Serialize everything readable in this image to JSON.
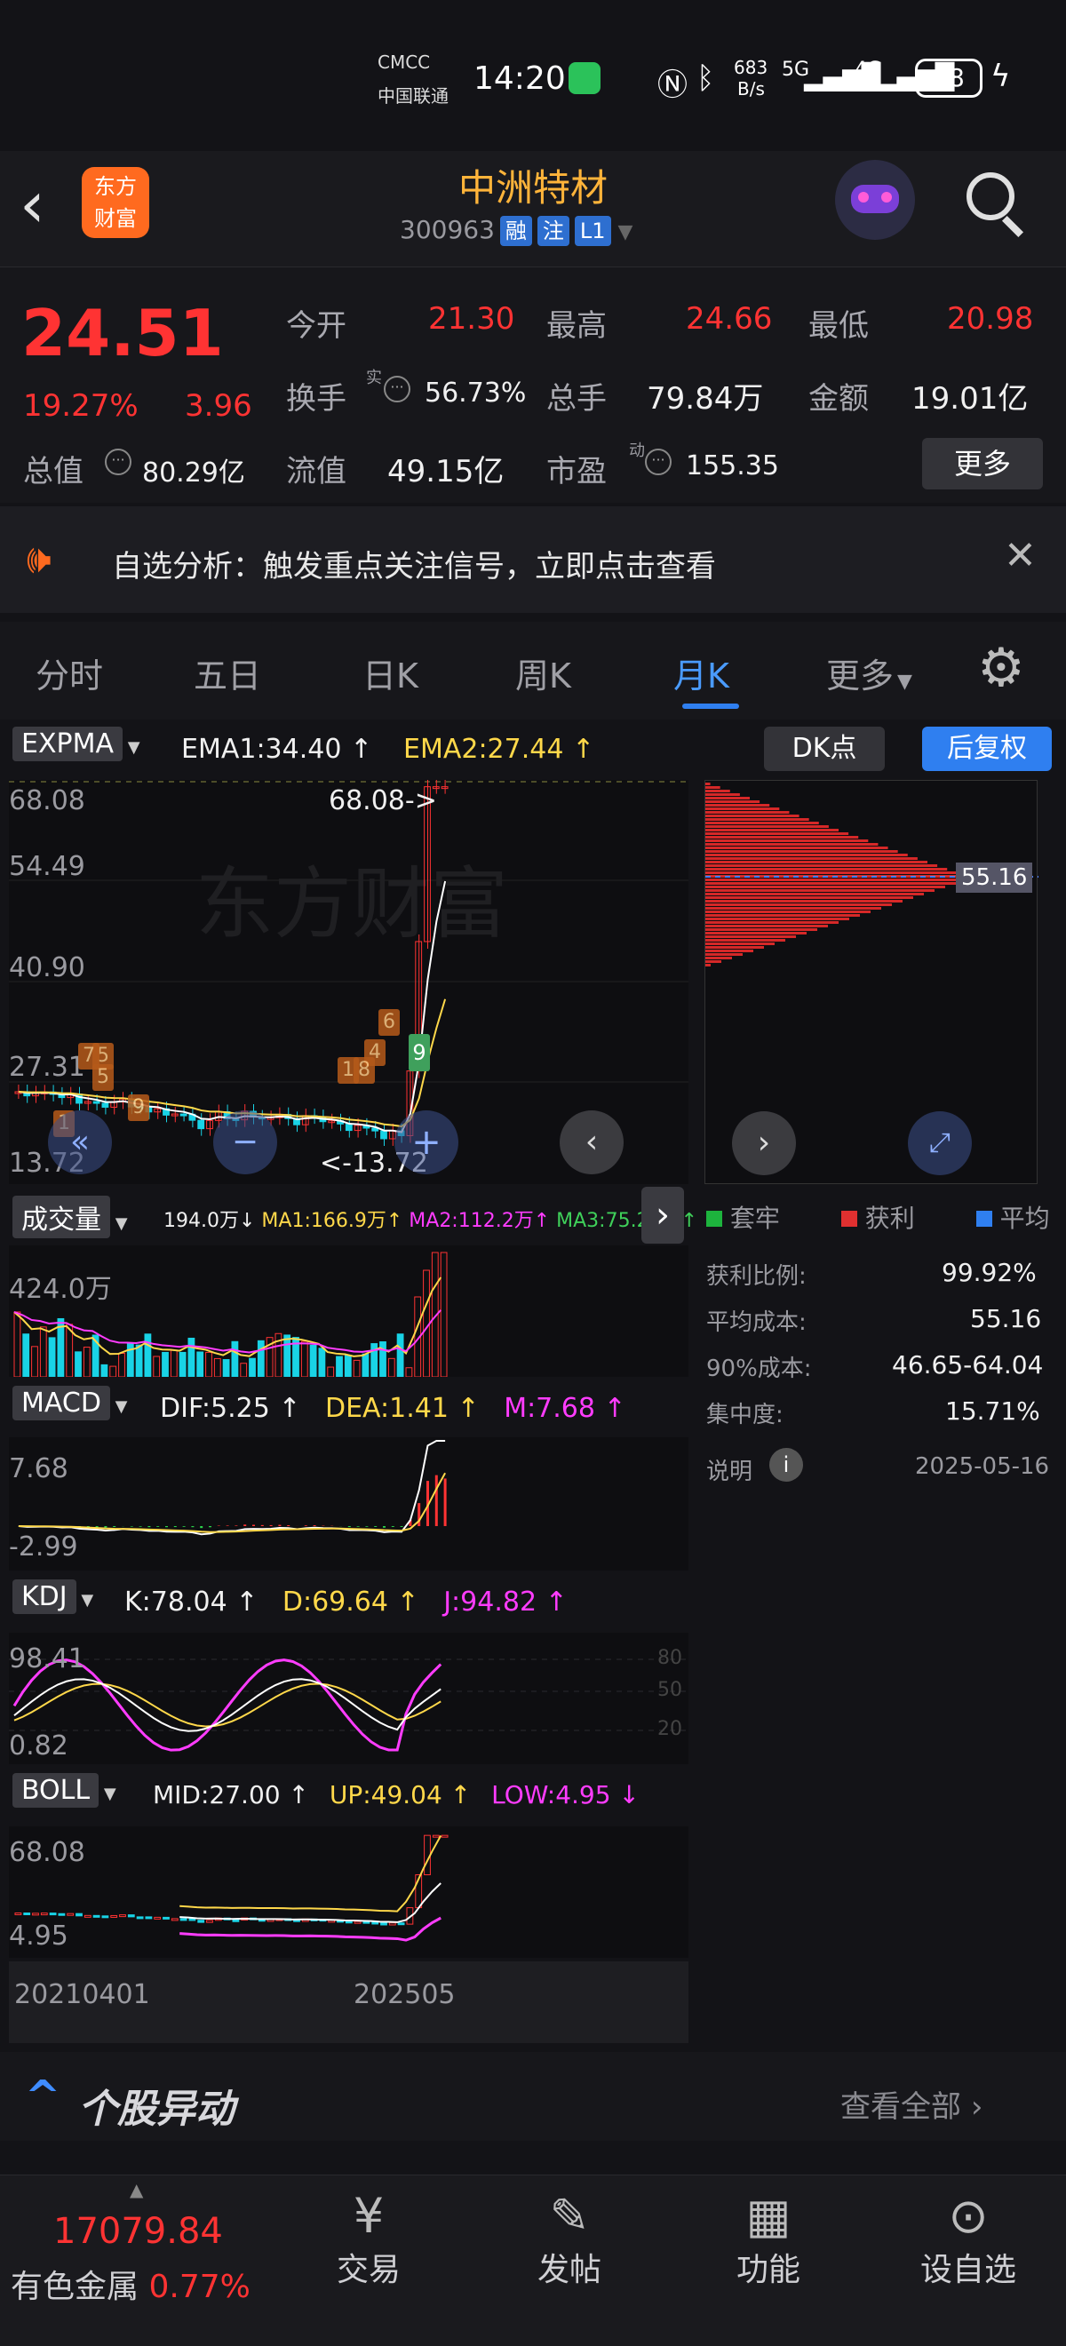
{
  "status": {
    "carrier1": "CMCC",
    "carrier2": "中国联通",
    "time": "14:20",
    "net_speed": "683",
    "net_unit": "B/s",
    "sig1": "5G",
    "sig2": "4G",
    "battery": "98"
  },
  "header": {
    "title": "中洲特材",
    "code": "300963",
    "tags": [
      "融",
      "注",
      "L1"
    ]
  },
  "quote": {
    "price": "24.51",
    "pct": "19.27%",
    "change": "3.96",
    "open_label": "今开",
    "open": "21.30",
    "high_label": "最高",
    "high": "24.66",
    "low_label": "最低",
    "low": "20.98",
    "turnover_label": "换手",
    "turnover_sup": "实",
    "turnover": "56.73%",
    "vol_label": "总手",
    "vol": "79.84万",
    "amt_label": "金额",
    "amt": "19.01亿",
    "mcap_label": "总值",
    "mcap": "80.29亿",
    "float_label": "流值",
    "float": "49.15亿",
    "pe_label": "市盈",
    "pe_sup": "动",
    "pe": "155.35",
    "more": "更多"
  },
  "banner": {
    "text": "自选分析：触发重点关注信号，立即点击查看"
  },
  "tabs": [
    "分时",
    "五日",
    "日K",
    "周K",
    "月K",
    "更多"
  ],
  "active_tab": "月K",
  "main_chart": {
    "indicator": "EXPMA",
    "ema1_label": "EMA1:34.40 ↑",
    "ema2_label": "EMA2:27.44 ↑",
    "dk_button": "DK点",
    "fq_button": "后复权",
    "y_labels": [
      "68.08",
      "54.49",
      "40.90",
      "27.31",
      "13.72"
    ],
    "max_note": "68.08->",
    "min_note": "<-13.72",
    "watermark": "东方财富",
    "markers": [
      "9",
      "6",
      "4",
      "1",
      "8",
      "5",
      "7",
      "9",
      "1",
      "5"
    ]
  },
  "chip": {
    "price_tag": "55.16",
    "legend": [
      "套牢",
      "获利",
      "平均"
    ],
    "rows": [
      [
        "获利比例:",
        "99.92%"
      ],
      [
        "平均成本:",
        "55.16"
      ],
      [
        "90%成本:",
        "46.65-64.04"
      ],
      [
        "集中度:",
        "15.71%"
      ]
    ],
    "note_label": "说明",
    "date": "2025-05-16"
  },
  "volume": {
    "label": "成交量",
    "v": "194.0万↓",
    "ma1": "MA1:166.9万↑",
    "ma2": "MA2:112.2万↑",
    "ma3": "MA3:75.28万↑",
    "y_top": "424.0万"
  },
  "macd": {
    "label": "MACD",
    "dif": "DIF:5.25 ↑",
    "dea": "DEA:1.41 ↑",
    "m": "M:7.68 ↑",
    "y_top": "7.68",
    "y_bottom": "-2.99"
  },
  "kdj": {
    "label": "KDJ",
    "k": "K:78.04 ↑",
    "d": "D:69.64 ↑",
    "j": "J:94.82 ↑",
    "y_top": "98.41",
    "y_bottom": "0.82",
    "levels": [
      "80",
      "50",
      "20"
    ]
  },
  "boll": {
    "label": "BOLL",
    "mid": "MID:27.00 ↑",
    "up": "UP:49.04 ↑",
    "low": "LOW:4.95 ↓",
    "y_top": "68.08",
    "y_bottom": "4.95"
  },
  "xaxis": {
    "start": "20210401",
    "end": "202505"
  },
  "section": {
    "title": "个股异动",
    "link": "查看全部"
  },
  "bottom": {
    "index_value": "17079.84",
    "index_name": "有色金属",
    "index_pct": "0.77%",
    "nav": [
      "交易",
      "发帖",
      "功能",
      "设自选"
    ]
  }
}
